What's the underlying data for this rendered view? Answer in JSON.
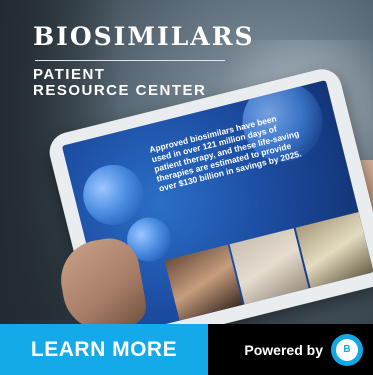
{
  "banner": {
    "title": "BIOSIMILARS",
    "subtitle_line1": "PATIENT",
    "subtitle_line2": "RESOURCE CENTER"
  },
  "tablet": {
    "stat_text": "Approved biosimilars have been used in over 121 million days of patient therapy, and these life-saving therapies are estimated to provide over $130 billion in savings by 2025."
  },
  "footer": {
    "cta_label": "LEARN MORE",
    "powered_label": "Powered by",
    "logo_text": "B"
  },
  "colors": {
    "accent": "#14a9e8",
    "footer_dark": "#000000"
  }
}
